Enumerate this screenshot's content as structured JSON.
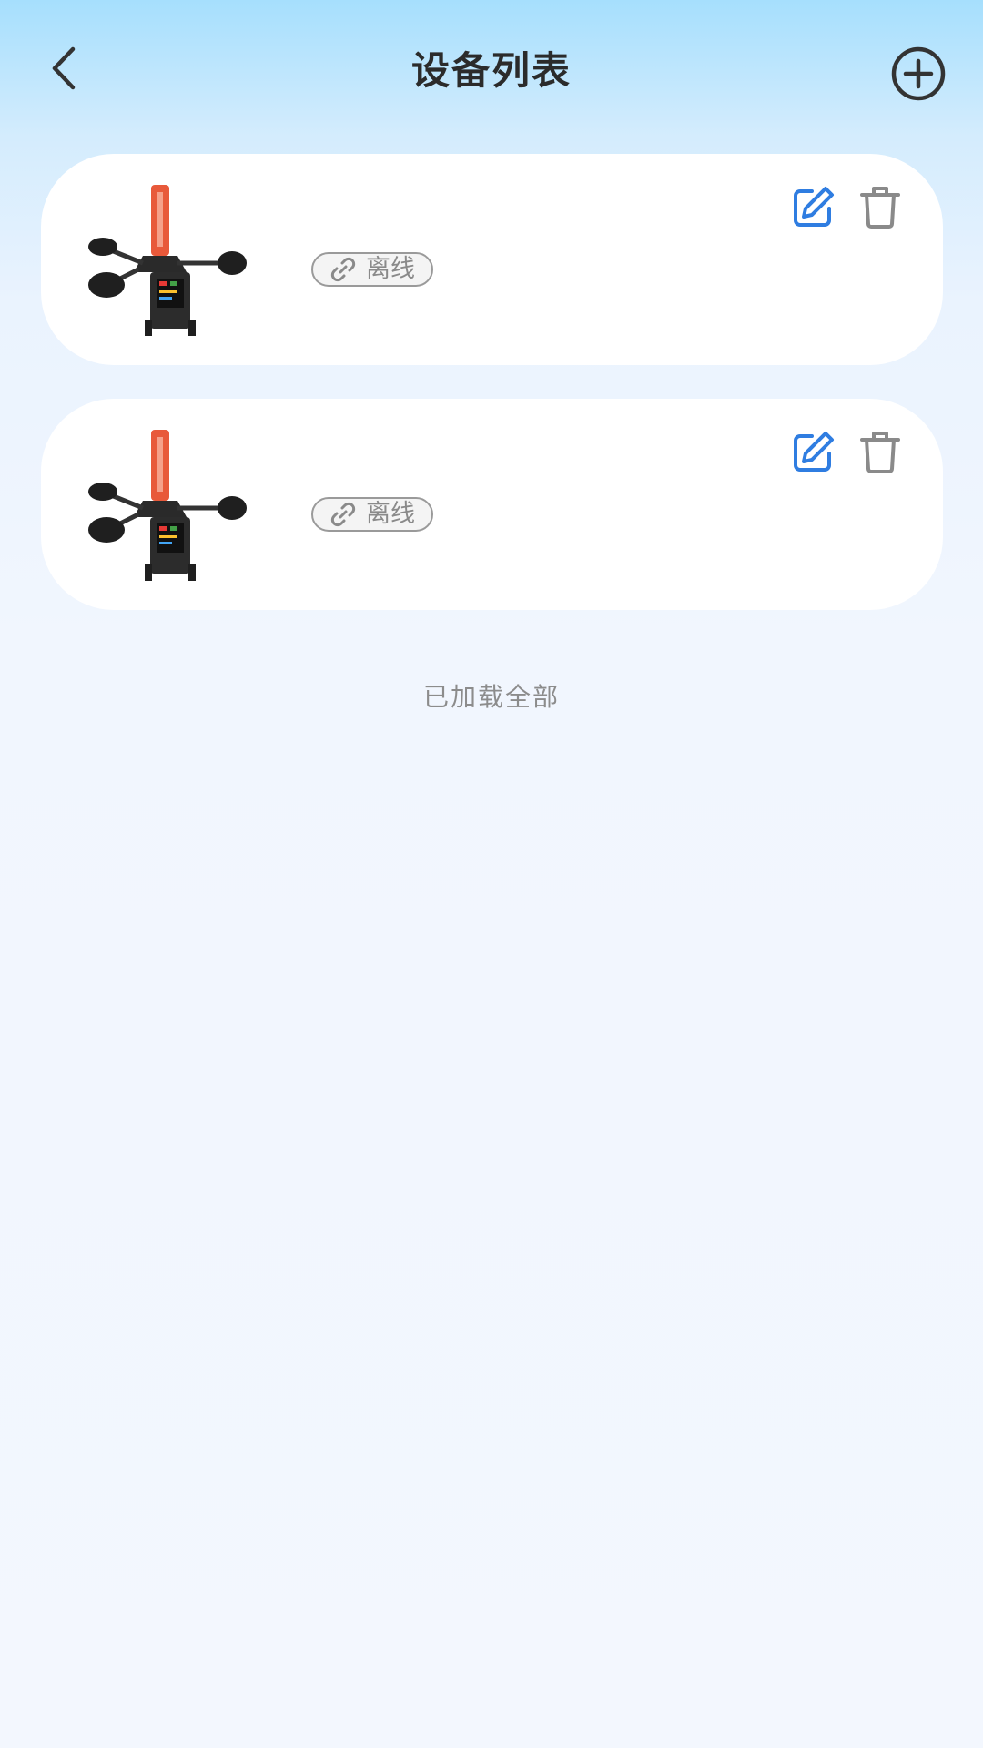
{
  "header": {
    "title": "设备列表",
    "back_icon": "chevron-left-icon",
    "add_icon": "plus-circle-icon"
  },
  "devices": [
    {
      "status_label": "离线",
      "status_icon": "link-icon",
      "edit_icon": "edit-icon",
      "delete_icon": "trash-icon"
    },
    {
      "status_label": "离线",
      "status_icon": "link-icon",
      "edit_icon": "edit-icon",
      "delete_icon": "trash-icon"
    }
  ],
  "footer": {
    "loaded_all_text": "已加载全部"
  },
  "colors": {
    "accent_blue": "#2f7de1",
    "icon_gray": "#8a8a8a",
    "title_text": "#2b2b2b"
  }
}
